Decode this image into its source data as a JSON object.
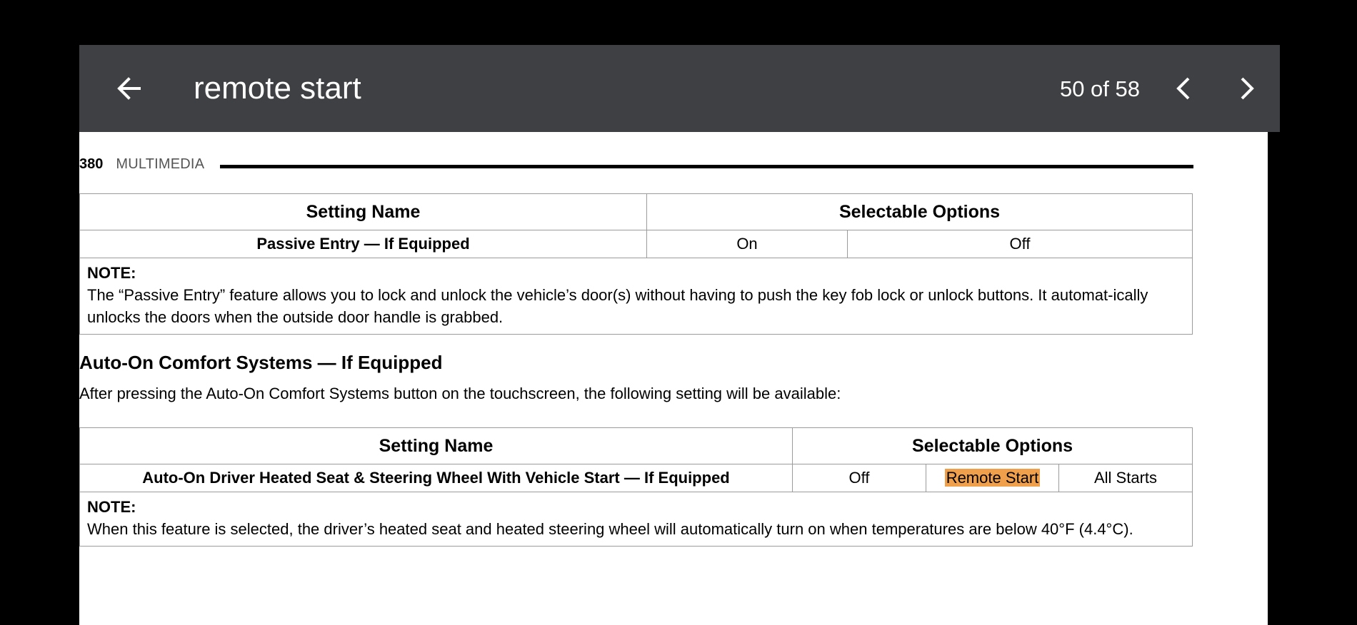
{
  "toolbar": {
    "query": "remote start",
    "counter": "50 of 58",
    "icons": {
      "back": "arrow-left-icon",
      "prev": "chevron-left-icon",
      "next": "chevron-right-icon"
    }
  },
  "page": {
    "number": "380",
    "section": "MULTIMEDIA",
    "table1": {
      "headers": [
        "Setting Name",
        "Selectable Options"
      ],
      "row": {
        "name": "Passive Entry — If Equipped",
        "options": [
          "On",
          "Off"
        ]
      },
      "note_label": "NOTE:",
      "note_text": "The “Passive Entry” feature allows you to lock and unlock the vehicle’s door(s) without having to push the key fob lock or unlock buttons. It automat-ically unlocks the doors when the outside door handle is grabbed."
    },
    "subheading": "Auto-On Comfort Systems — If Equipped",
    "body": "After pressing the Auto-On Comfort Systems button on the touchscreen, the following setting will be available:",
    "table2": {
      "headers": [
        "Setting Name",
        "Selectable Options"
      ],
      "row": {
        "name": "Auto-On Driver Heated Seat & Steering Wheel With Vehicle Start — If Equipped",
        "options": [
          "Off",
          "Remote Start",
          "All Starts"
        ]
      },
      "note_label": "NOTE:",
      "note_text": "When this feature is selected, the driver’s heated seat and heated steering wheel will automatically turn on when temperatures are below 40°F (4.4°C)."
    }
  },
  "colors": {
    "toolbar": "#3f4043",
    "highlight": "#f0a04b"
  }
}
